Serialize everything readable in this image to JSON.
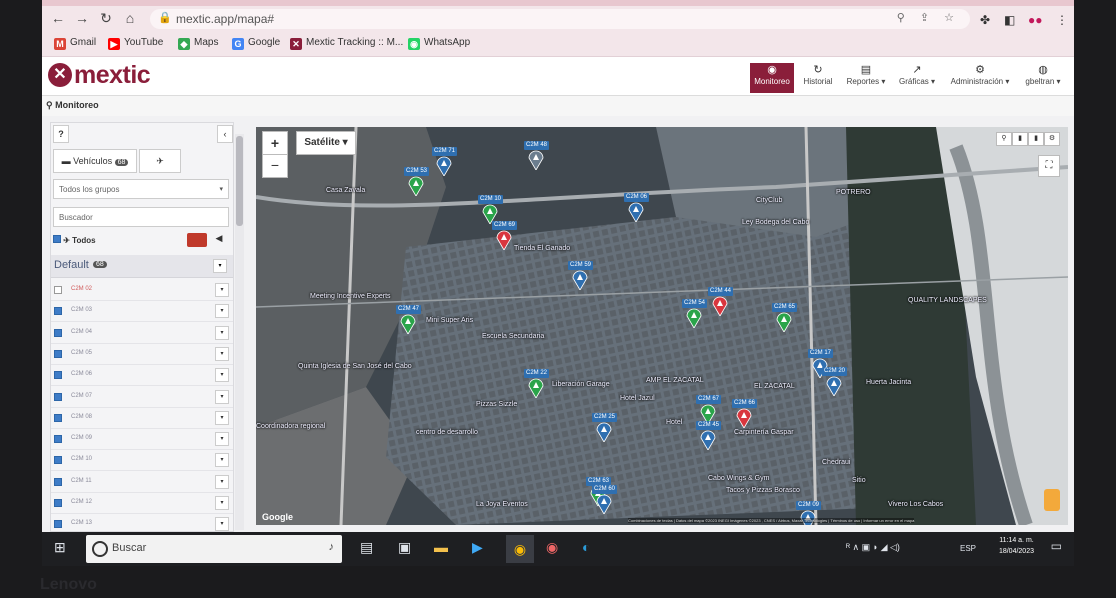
{
  "browser": {
    "url": "mextic.app/mapa#",
    "bookmarks": [
      {
        "label": "Gmail",
        "color": "#db4437",
        "glyph": "M"
      },
      {
        "label": "YouTube",
        "color": "#ff0000",
        "glyph": "▶"
      },
      {
        "label": "Maps",
        "color": "#34a853",
        "glyph": "◆"
      },
      {
        "label": "Google",
        "color": "#4285f4",
        "glyph": "G"
      },
      {
        "label": "Mextic Tracking :: M...",
        "color": "#8a1e3a",
        "glyph": "✕"
      },
      {
        "label": "WhatsApp",
        "color": "#25d366",
        "glyph": "◉"
      }
    ]
  },
  "app": {
    "logo_text": "mextic",
    "nav": [
      {
        "label": "Monitoreo",
        "icon": "◉"
      },
      {
        "label": "Historial",
        "icon": "↻"
      },
      {
        "label": "Reportes ▾",
        "icon": "▤"
      },
      {
        "label": "Gráficas ▾",
        "icon": "↗"
      },
      {
        "label": "Administración ▾",
        "icon": "⚙"
      },
      {
        "label": "gbeltran ▾",
        "icon": "◍"
      }
    ],
    "breadcrumb": "Monitoreo"
  },
  "panel": {
    "help": "?",
    "collapse": "‹",
    "tab_vehicles": "Vehículos",
    "tab_vehicles_count": "68",
    "groups_select": "Todos los grupos",
    "search_placeholder": "Buscador",
    "all_label": "Todos",
    "group_name": "Default",
    "group_count": "68",
    "units": [
      "C2M 02",
      "C2M 03",
      "C2M 04",
      "C2M 05",
      "C2M 06",
      "C2M 07",
      "C2M 08",
      "C2M 09",
      "C2M 10",
      "C2M 11",
      "C2M 12",
      "C2M 13"
    ]
  },
  "map": {
    "type_button": "Satélite ▾",
    "zoom_in": "+",
    "zoom_out": "−",
    "google": "Google",
    "attribution": "Combinaciones de teclas | Datos del mapa ©2023 INEGI Imágenes ©2023 , CNES / Airbus, Maxar Technologies | Términos de uso | Informar un error en el mapa",
    "vehicle_labels": [
      "C2M 71",
      "C2M 48",
      "C2M 53",
      "C2M 10",
      "C2M 69",
      "C2M 06",
      "C2M 59",
      "C2M 47",
      "C2M 44",
      "C2M 54",
      "C2M 65",
      "C2M 17",
      "C2M 20",
      "C2M 22",
      "C2M 25",
      "C2M 67",
      "C2M 66",
      "C2M 45",
      "C2M 63",
      "C2M 60",
      "C2M 09"
    ],
    "places": [
      "Casa Zavala",
      "Meeting Incentive Experts",
      "Mini Super Aris",
      "Escuela Secundaria",
      "Quinta Iglesia de San José del Cabo",
      "Coordinadora regional",
      "centro de desarrollo",
      "AMP EL ZACATAL",
      "EL ZACATAL",
      "Hotel Jazul",
      "Hotel",
      "Tienda El Ganado",
      "Pizzas Sizzle",
      "La Joya Eventos",
      "Liberación Garage",
      "Cabo Wings & Gym",
      "Carpintería Gaspar",
      "Tacos y Pizzas Borasco",
      "Vivero Los Cabos",
      "Huerta Jacinta",
      "QUALITY LANDSCAPES",
      "CityClub",
      "Ley Bodega del Cabo",
      "POTRERO",
      "Chedraui",
      "Sitio"
    ]
  },
  "taskbar": {
    "search": "Buscar",
    "lang": "ESP",
    "time": "11:14 a. m.",
    "date": "18/04/2023"
  },
  "bezel": "Lenovo"
}
